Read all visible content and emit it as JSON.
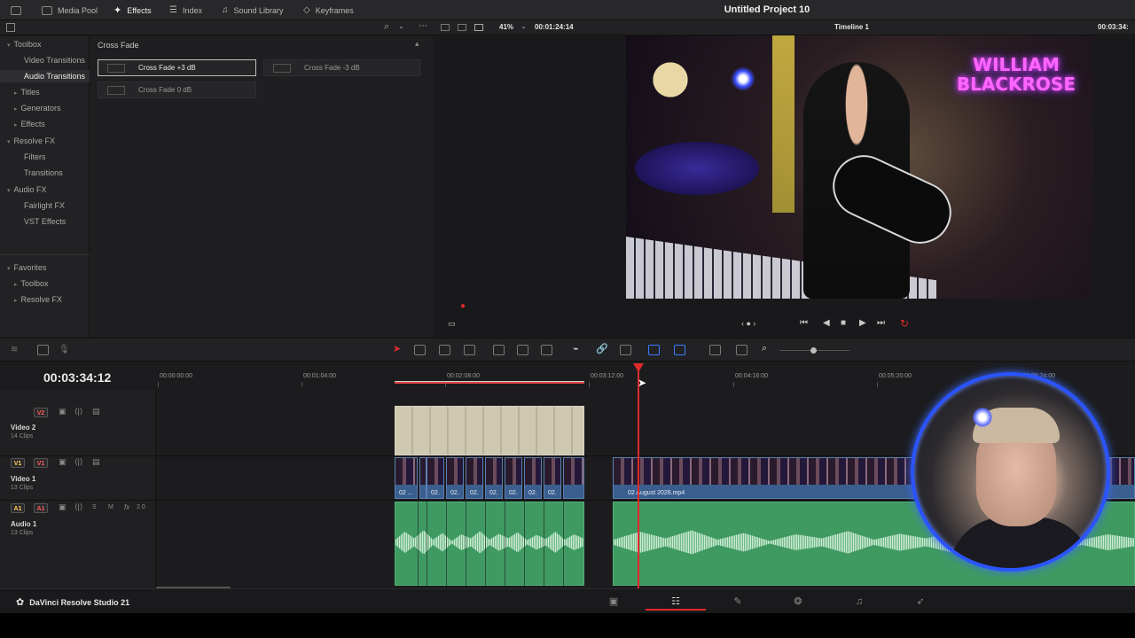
{
  "topbar": {
    "media_pool": "Media Pool",
    "effects": "Effects",
    "index": "Index",
    "sound_library": "Sound Library",
    "keyframes": "Keyframes",
    "project_title": "Untitled Project 10"
  },
  "viewer_bar": {
    "zoom": "41%",
    "timecode": "00:01:24:14",
    "timeline_name": "Timeline 1",
    "timecode_right": "00:03:34:"
  },
  "effects_tree": {
    "toolbox": "Toolbox",
    "video_transitions": "Video Transitions",
    "audio_transitions": "Audio Transitions",
    "titles": "Titles",
    "generators": "Generators",
    "effects": "Effects",
    "resolve_fx": "Resolve FX",
    "filters": "Filters",
    "transitions": "Transitions",
    "audio_fx": "Audio FX",
    "fairlight_fx": "Fairlight FX",
    "vst_effects": "VST Effects",
    "favorites": "Favorites",
    "fav_toolbox": "Toolbox",
    "fav_resolve_fx": "Resolve FX"
  },
  "effects_list": {
    "header": "Cross Fade",
    "items": [
      "Cross Fade +3 dB",
      "Cross Fade -3 dB",
      "Cross Fade 0 dB"
    ]
  },
  "video_overlay": {
    "line1": "WILLIAM",
    "line2": "BLACKROSE"
  },
  "timeline": {
    "current_timecode": "00:03:34:12",
    "ruler": [
      "00:00:00:00",
      "00:01:04:00",
      "00:02:08:00",
      "00:03:12:00",
      "00:04:16:00",
      "00:05:20:00",
      "00:06:24:00"
    ],
    "tracks": {
      "v2": {
        "badge": "V2",
        "name": "Video 2",
        "sub": "14 Clips"
      },
      "v1": {
        "src": "V1",
        "badge": "V1",
        "name": "Video 1",
        "sub": "13 Clips"
      },
      "a1": {
        "src": "A1",
        "badge": "A1",
        "name": "Audio 1",
        "sub": "13 Clips",
        "level": "2.0",
        "solo": "S",
        "mute": "M",
        "fx": "fx"
      }
    },
    "v1_clip_labels": [
      "02 ...",
      "02...",
      "02...",
      "02...",
      "02...",
      "02...",
      "02...",
      "02...",
      "02 August 2026.mp4"
    ]
  },
  "footer": {
    "app_name": "DaVinci Resolve Studio 21"
  },
  "colors": {
    "accent": "#e02a2a",
    "video_clip": "#3a5f8f",
    "audio_clip": "#3f9a62",
    "cam_ring": "#2a54ff"
  }
}
